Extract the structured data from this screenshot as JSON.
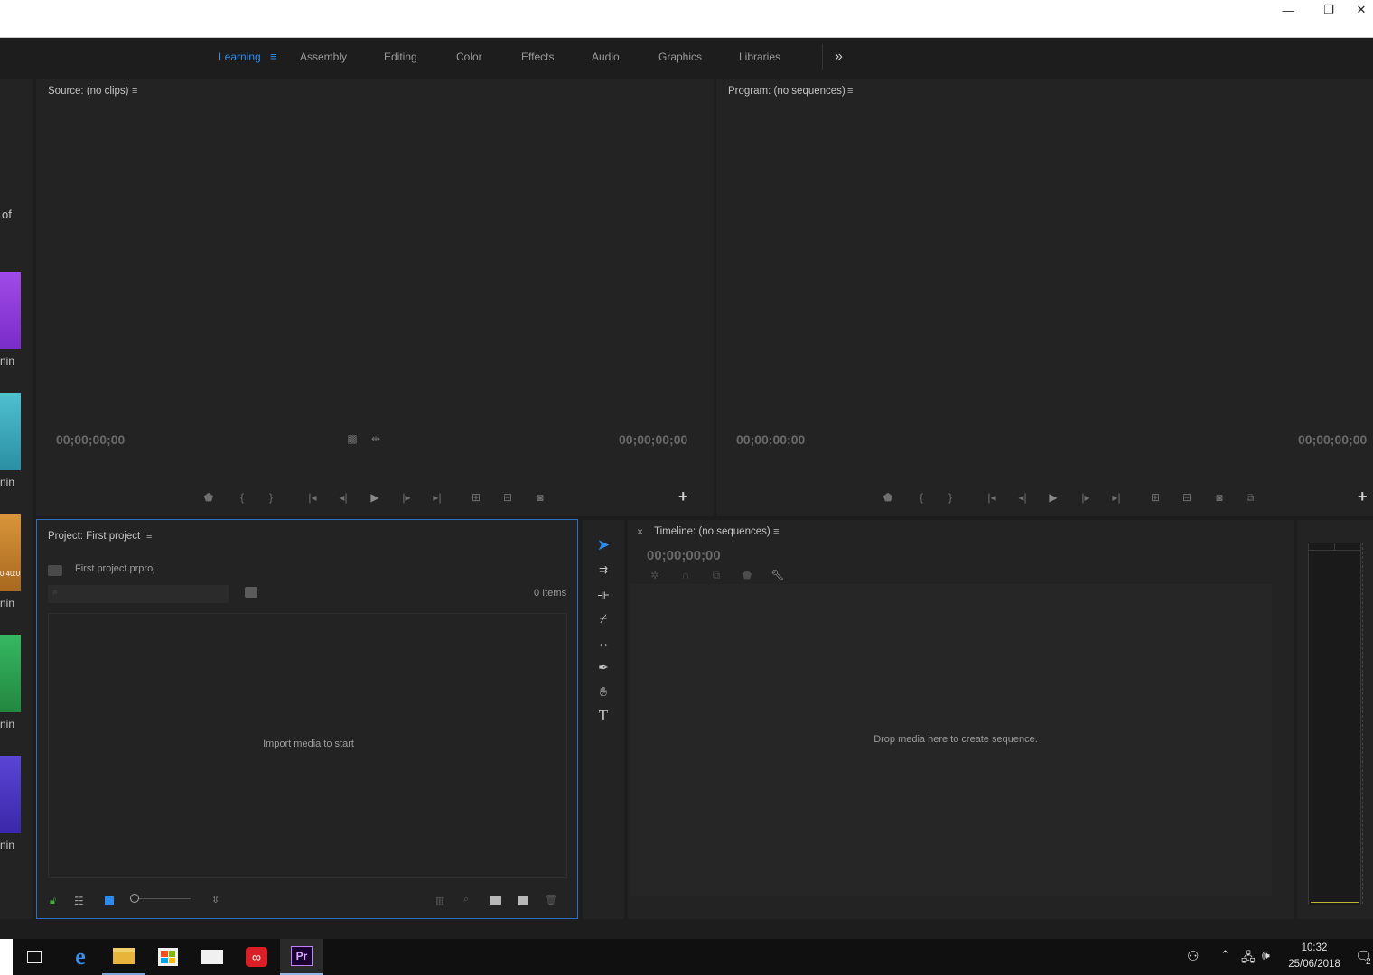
{
  "workspaces": {
    "tabs": [
      "Learning",
      "Assembly",
      "Editing",
      "Color",
      "Effects",
      "Audio",
      "Graphics",
      "Libraries"
    ],
    "active": "Learning",
    "overflow_glyph": "»"
  },
  "window_controls": {
    "minimize": "—",
    "restore": "❐",
    "close": "✕"
  },
  "learning_strip": {
    "partial_text": "of",
    "items": [
      {
        "label": "nin",
        "color": "#8f3fd8"
      },
      {
        "label": "nin",
        "color": "#3aa7b8"
      },
      {
        "label": "nin",
        "color": "#c9832a",
        "overlay": "0:40:0"
      },
      {
        "label": "nin",
        "color": "#2fa155"
      },
      {
        "label": "nin",
        "color": "#4a35c4"
      }
    ]
  },
  "source_monitor": {
    "title": "Source: (no clips)",
    "timecode_left": "00;00;00;00",
    "timecode_right": "00;00;00;00",
    "add_button": "+"
  },
  "program_monitor": {
    "title": "Program: (no sequences)",
    "timecode_left": "00;00;00;00",
    "timecode_right": "00;00;00;00",
    "add_button": "+"
  },
  "project_panel": {
    "title": "Project: First project",
    "file_name": "First project.prproj",
    "search_placeholder": "",
    "item_count": "0 Items",
    "empty_message": "Import media to start",
    "zoom_fraction": 0.0
  },
  "tools": [
    "selection-tool",
    "track-select-tool",
    "ripple-edit-tool",
    "razor-tool",
    "slip-tool",
    "pen-tool",
    "hand-tool",
    "type-tool"
  ],
  "timeline_panel": {
    "title": "Timeline: (no sequences)",
    "close_glyph": "×",
    "timecode": "00;00;00;00",
    "empty_message": "Drop media here to create sequence."
  },
  "taskbar": {
    "time": "10:32",
    "date": "25/06/2018",
    "notification_count": "2",
    "app_label_premiere": "Pr"
  }
}
